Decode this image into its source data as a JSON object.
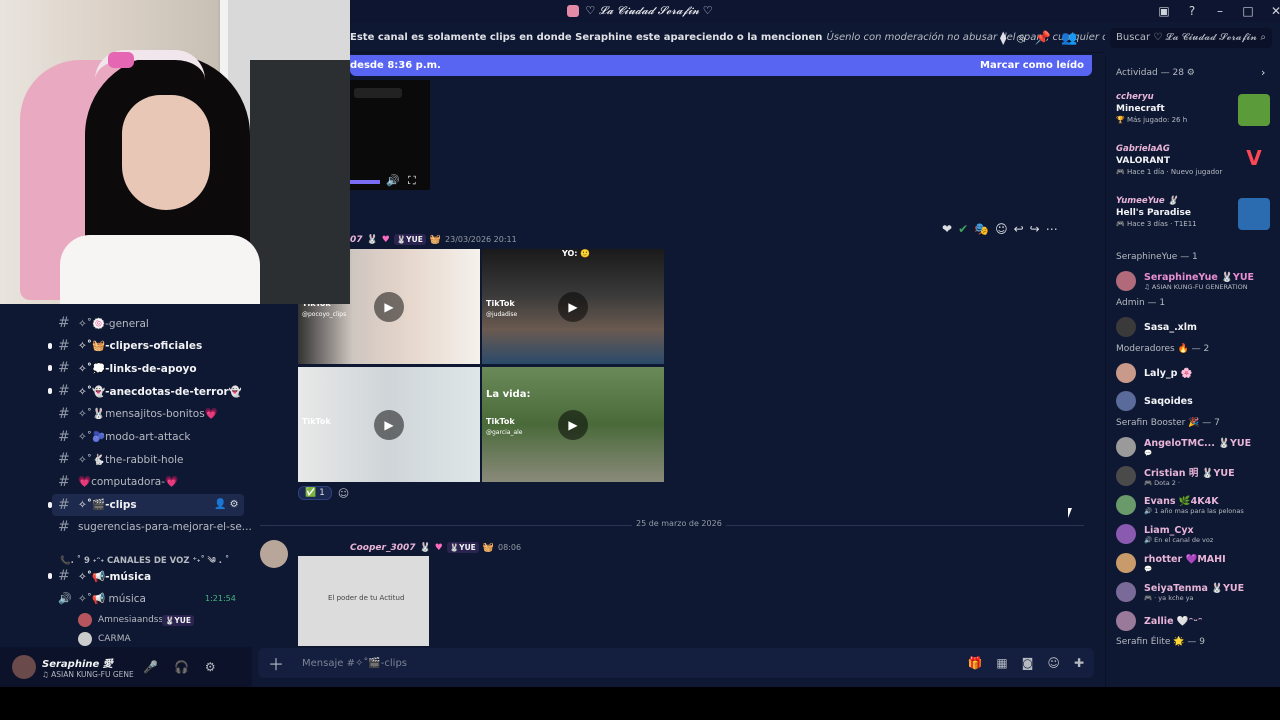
{
  "window": {
    "title": "♡ 𝓛𝓪 𝓒𝓲𝓾𝓭𝓪𝓭 𝓢𝓮𝓻𝓪𝓯𝓲𝓷 ♡"
  },
  "header": {
    "topic_bold": "Este canal es solamente clips en donde Seraphine este apareciendo o la mencionen",
    "topic_rest": "Úsenlo con moderación no abusar del spam, cualquier otro link/post que ...",
    "search_placeholder": "Buscar ♡ 𝓛𝓪 𝓒𝓲𝓾𝓭𝓪𝓭 𝓢𝓮𝓻𝓪𝓯𝓲𝓷"
  },
  "new_messages_bar": {
    "text": "desde 8:36 p.m.",
    "action": "Marcar como leído"
  },
  "channels": [
    {
      "name": "✧˚🍥-general",
      "bright": false,
      "dot": false
    },
    {
      "name": "✧˚🧺-clipers-oficiales",
      "bright": true,
      "dot": true
    },
    {
      "name": "✧˚💭-links-de-apoyo",
      "bright": true,
      "dot": true
    },
    {
      "name": "✧˚👻-anecdotas-de-terror👻",
      "bright": true,
      "dot": true
    },
    {
      "name": "✧˚🐰mensajitos-bonitos💗",
      "bright": false,
      "dot": false
    },
    {
      "name": "✧˚🫐modo-art-attack",
      "bright": false,
      "dot": false
    },
    {
      "name": "✧˚🐇the-rabbit-hole",
      "bright": false,
      "dot": false
    },
    {
      "name": "💗computadora-💗",
      "bright": false,
      "dot": false
    },
    {
      "name": "✧˚🎬-clips",
      "bright": true,
      "dot": true,
      "active": true
    },
    {
      "name": "sugerencias-para-mejorar-el-se...",
      "bright": false,
      "dot": false
    }
  ],
  "voice_category": "📞. ˚ 9 ˖ᵔ˖ CANALES DE VOZ ⁺˖˚ ༄ . ˚",
  "voice_channels": {
    "music_text": "✧˚📢-música",
    "music_voice": "✧˚📢 música",
    "music_time": "1:21:54",
    "users": [
      "Amnesiaandss",
      "CARMA"
    ],
    "user_tag": "🐰YUE"
  },
  "user_panel": {
    "name": "Seraphine 愛",
    "status": "♫ ASIAN KUNG-FU GENE"
  },
  "messages": [
    {
      "author": "07",
      "tag": "🐰YUE",
      "time": "23/03/2026 20:11",
      "reactions": [
        "✅ 1"
      ]
    },
    {
      "author": "Cooper_3007",
      "tag": "🐰YUE",
      "time": "08:06"
    }
  ],
  "video_tiles": [
    {
      "label": "TikTok",
      "sub": "@pocoyo_clips",
      "overlay": ""
    },
    {
      "label": "TikTok",
      "sub": "@judadise",
      "overlay": "YO: 🙂"
    },
    {
      "label": "TikTok",
      "sub": "",
      "overlay": ""
    },
    {
      "label": "TikTok",
      "sub": "@garcia_ale",
      "overlay": "La vida:"
    }
  ],
  "video2_caption": "El poder de tu Actitud",
  "date_divider": "25 de marzo de 2026",
  "composer_placeholder": "Mensaje #✧˚🎬-clips",
  "members": {
    "activity_header": "Actividad — 28 ⚙",
    "activity": [
      {
        "user": "ccheryu",
        "game": "Minecraft",
        "status": "🏆 Más jugado: 26 h"
      },
      {
        "user": "GabrielaAG",
        "game": "VALORANT",
        "status": "🎮 Hace 1 día · Nuevo jugador"
      },
      {
        "user": "YumeeYue 🐰",
        "game": "Hell's Paradise",
        "status": "🎮 Hace 3 días · T1E11"
      }
    ],
    "groups": [
      {
        "header": "SeraphineYue — 1",
        "members": [
          {
            "name": "SeraphineYue 🐰YUE",
            "status": "♫ ASIAN KUNG-FU GENERATION",
            "color": "#e88fd2"
          }
        ]
      },
      {
        "header": "Admin — 1",
        "members": [
          {
            "name": "Sasa_.xlm",
            "status": "",
            "color": "#f2f3f5"
          }
        ]
      },
      {
        "header": "Moderadores 🔥 — 2",
        "members": [
          {
            "name": "Laly_p 🌸",
            "status": "",
            "color": "#f2f3f5"
          },
          {
            "name": "Saqoides",
            "status": "",
            "color": "#f2f3f5"
          }
        ]
      },
      {
        "header": "Serafin Booster 🎉 — 7",
        "members": [
          {
            "name": "AngeloTMC... 🐰YUE",
            "status": "💬",
            "color": "#e8b4d8"
          },
          {
            "name": "Cristian 明 🐰YUE",
            "status": "🎮 Dota 2 ·",
            "color": "#e8b4d8"
          },
          {
            "name": "Evans 🌿4K4K",
            "status": "🔊 1 año mas para las pelonas",
            "color": "#e8b4d8"
          },
          {
            "name": "Liam_Cyx",
            "status": "🔊 En el canal de voz",
            "color": "#e8b4d8"
          },
          {
            "name": "rhotter 💜MAHI",
            "status": "💬",
            "color": "#e8b4d8"
          },
          {
            "name": "SeiyaTenma 🐰YUE",
            "status": "🎮 · ya kche ya",
            "color": "#e8b4d8"
          },
          {
            "name": "Zallie 🤍ᵔᵕᵔ",
            "status": "",
            "color": "#e8b4d8"
          }
        ]
      },
      {
        "header": "Serafin Élite 🌟 — 9",
        "members": []
      }
    ]
  }
}
